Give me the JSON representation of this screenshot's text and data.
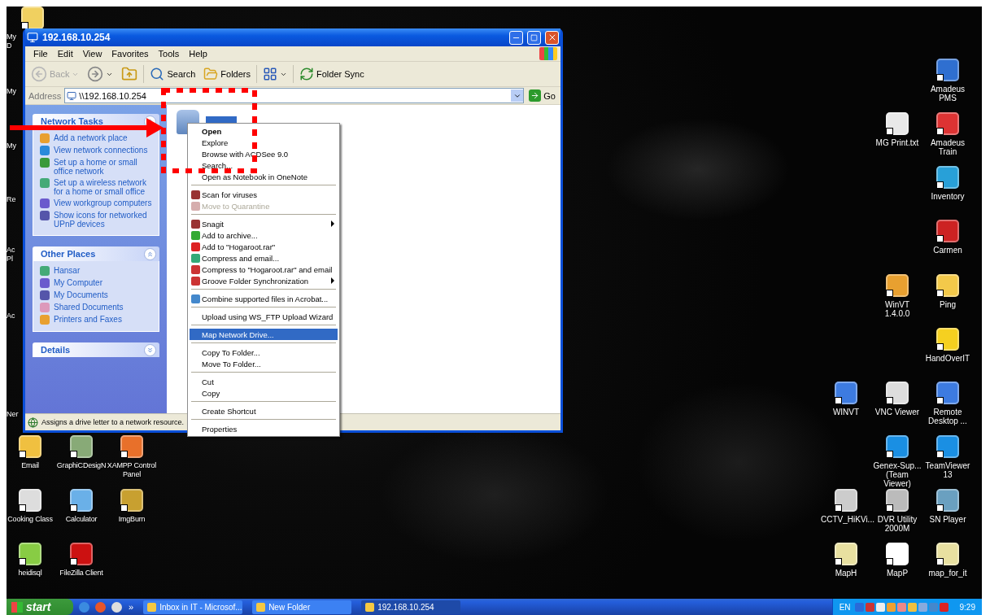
{
  "desktop": {
    "left_edge_labels": [
      "My D",
      "My",
      "My",
      "Re",
      "Ac Pl",
      "Ac",
      "Ner"
    ],
    "bottom_left_icons": [
      "Email",
      "GraphiCDesigN",
      "XAMPP Control Panel",
      "Cooking Class",
      "Calculator",
      "ImgBurn",
      "heidisql",
      "FileZilla Client"
    ],
    "right_icons": [
      "Amadeus PMS",
      "MG Print.txt",
      "Amadeus Train",
      "Inventory",
      "Carmen",
      "WinVT 1.4.0.0",
      "Ping",
      "HandOverIT",
      "WINVT",
      "VNC Viewer",
      "Remote Desktop ...",
      "Genex-Sup... (Team Viewer)",
      "TeamViewer 13",
      "CCTV_HiKVi...",
      "DVR Utility 2000M",
      "SN Player",
      "MapH",
      "MapP",
      "map_for_it"
    ]
  },
  "window": {
    "title": "192.168.10.254",
    "menu": [
      "File",
      "Edit",
      "View",
      "Favorites",
      "Tools",
      "Help"
    ],
    "toolbar": [
      {
        "kind": "back",
        "label": "Back",
        "disabled": true
      },
      {
        "kind": "forward",
        "disabled": false
      },
      {
        "kind": "up",
        "disabled": false
      },
      {
        "kind": "search",
        "label": "Search",
        "disabled": false
      },
      {
        "kind": "folders",
        "label": "Folders",
        "disabled": false
      },
      {
        "kind": "views",
        "disabled": false
      },
      {
        "kind": "sync",
        "label": "Folder Sync",
        "disabled": false
      }
    ],
    "address": {
      "label": "Address",
      "value": "\\\\192.168.10.254",
      "go": "Go"
    },
    "task_panes": [
      {
        "title": "Network Tasks",
        "expanded": true,
        "links": [
          "Add a network place",
          "View network connections",
          "Set up a home or small office network",
          "Set up a wireless network for a home or small office",
          "View workgroup computers",
          "Show icons for networked UPnP devices"
        ]
      },
      {
        "title": "Other Places",
        "expanded": true,
        "links": [
          "Hansar",
          "My Computer",
          "My Documents",
          "Shared Documents",
          "Printers and Faxes"
        ]
      },
      {
        "title": "Details",
        "expanded": false
      }
    ],
    "status_bar": "Assigns a drive letter to a network resource."
  },
  "context_menu": [
    {
      "kind": "item",
      "label": "Open",
      "bold": true,
      "icon": false,
      "disabled": false,
      "submenu": false,
      "selected": false
    },
    {
      "kind": "item",
      "label": "Explore",
      "bold": false,
      "icon": false,
      "disabled": false,
      "submenu": false,
      "selected": false
    },
    {
      "kind": "item",
      "label": "Browse with ACDSee 9.0",
      "bold": false,
      "icon": false,
      "disabled": false,
      "submenu": false,
      "selected": false
    },
    {
      "kind": "item",
      "label": "Search...",
      "bold": false,
      "icon": false,
      "disabled": false,
      "submenu": false,
      "selected": false
    },
    {
      "kind": "item",
      "label": "Open as Notebook in OneNote",
      "bold": false,
      "icon": false,
      "disabled": false,
      "submenu": false,
      "selected": false
    },
    {
      "kind": "separator"
    },
    {
      "kind": "item",
      "label": "Scan for viruses",
      "bold": false,
      "icon": true,
      "disabled": false,
      "submenu": false,
      "selected": false
    },
    {
      "kind": "item",
      "label": "Move to Quarantine",
      "bold": false,
      "icon": true,
      "disabled": true,
      "submenu": false,
      "selected": false
    },
    {
      "kind": "separator"
    },
    {
      "kind": "item",
      "label": "Snagit",
      "bold": false,
      "icon": true,
      "disabled": false,
      "submenu": true,
      "selected": false
    },
    {
      "kind": "item",
      "label": "Add to archive...",
      "bold": false,
      "icon": true,
      "disabled": false,
      "submenu": false,
      "selected": false
    },
    {
      "kind": "item",
      "label": "Add to \"Hogaroot.rar\"",
      "bold": false,
      "icon": true,
      "disabled": false,
      "submenu": false,
      "selected": false
    },
    {
      "kind": "item",
      "label": "Compress and email...",
      "bold": false,
      "icon": true,
      "disabled": false,
      "submenu": false,
      "selected": false
    },
    {
      "kind": "item",
      "label": "Compress to \"Hogaroot.rar\" and email",
      "bold": false,
      "icon": true,
      "disabled": false,
      "submenu": false,
      "selected": false
    },
    {
      "kind": "item",
      "label": "Groove Folder Synchronization",
      "bold": false,
      "icon": true,
      "disabled": false,
      "submenu": true,
      "selected": false
    },
    {
      "kind": "separator"
    },
    {
      "kind": "item",
      "label": "Combine supported files in Acrobat...",
      "bold": false,
      "icon": true,
      "disabled": false,
      "submenu": false,
      "selected": false
    },
    {
      "kind": "separator"
    },
    {
      "kind": "item",
      "label": "Upload using WS_FTP Upload Wizard",
      "bold": false,
      "icon": false,
      "disabled": false,
      "submenu": false,
      "selected": false
    },
    {
      "kind": "separator"
    },
    {
      "kind": "item",
      "label": "Map Network Drive...",
      "bold": false,
      "icon": false,
      "disabled": false,
      "submenu": false,
      "selected": true
    },
    {
      "kind": "separator"
    },
    {
      "kind": "item",
      "label": "Copy To Folder...",
      "bold": false,
      "icon": false,
      "disabled": false,
      "submenu": false,
      "selected": false
    },
    {
      "kind": "item",
      "label": "Move To Folder...",
      "bold": false,
      "icon": false,
      "disabled": false,
      "submenu": false,
      "selected": false
    },
    {
      "kind": "separator"
    },
    {
      "kind": "item",
      "label": "Cut",
      "bold": false,
      "icon": false,
      "disabled": false,
      "submenu": false,
      "selected": false
    },
    {
      "kind": "item",
      "label": "Copy",
      "bold": false,
      "icon": false,
      "disabled": false,
      "submenu": false,
      "selected": false
    },
    {
      "kind": "separator"
    },
    {
      "kind": "item",
      "label": "Create Shortcut",
      "bold": false,
      "icon": false,
      "disabled": false,
      "submenu": false,
      "selected": false
    },
    {
      "kind": "separator"
    },
    {
      "kind": "item",
      "label": "Properties",
      "bold": false,
      "icon": false,
      "disabled": false,
      "submenu": false,
      "selected": false
    }
  ],
  "taskbar": {
    "start": "start",
    "more": "»",
    "tasks": [
      {
        "label": "Inbox in IT - Microsof...",
        "selected": false
      },
      {
        "label": "New Folder",
        "selected": false
      },
      {
        "label": "192.168.10.254",
        "selected": true
      }
    ],
    "language": "EN",
    "clock": "9:29"
  }
}
